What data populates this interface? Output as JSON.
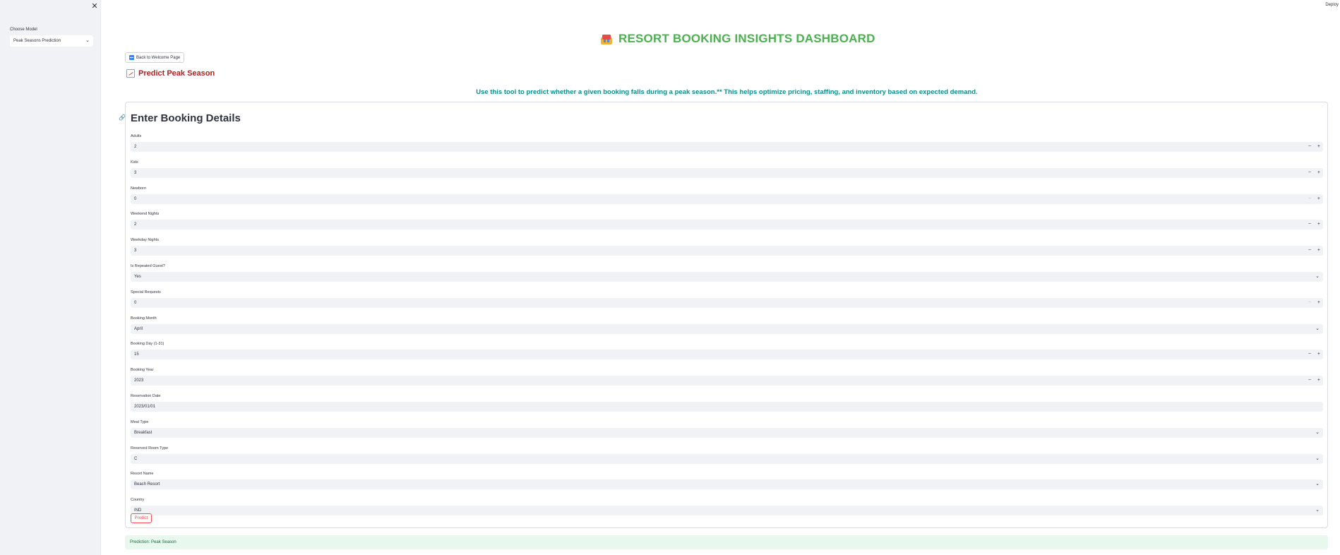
{
  "sidebar": {
    "model_label": "Choose Model",
    "model_value": "Peak Seasons Prediction"
  },
  "header": {
    "deploy_label": "Deploy"
  },
  "main": {
    "title": "RESORT BOOKING INSIGHTS DASHBOARD",
    "back_button": "Back to Welcome Page",
    "subheading": "Predict Peak Season",
    "intro": "Use this tool to predict whether a given booking falls during a peak season.** This helps optimize pricing, staffing, and inventory based on expected demand."
  },
  "form": {
    "heading": "Enter Booking Details",
    "fields": [
      {
        "label": "Adults",
        "value": "2",
        "kind": "number"
      },
      {
        "label": "Kids",
        "value": "3",
        "kind": "number"
      },
      {
        "label": "Newborn",
        "value": "0",
        "kind": "number-min"
      },
      {
        "label": "Weekend Nights",
        "value": "2",
        "kind": "number"
      },
      {
        "label": "Weekday Nights",
        "value": "3",
        "kind": "number"
      },
      {
        "label": "Is Repeated Guest?",
        "value": "Yes",
        "kind": "select"
      },
      {
        "label": "Special Requests",
        "value": "0",
        "kind": "number-min"
      },
      {
        "label": "Booking Month",
        "value": "April",
        "kind": "select"
      },
      {
        "label": "Booking Day (1-31)",
        "value": "15",
        "kind": "number"
      },
      {
        "label": "Booking Year",
        "value": "2023",
        "kind": "number"
      },
      {
        "label": "Reservation Date",
        "value": "2023/01/01",
        "kind": "date"
      },
      {
        "label": "Meal Type",
        "value": "Breakfast",
        "kind": "select"
      },
      {
        "label": "Reserved Room Type",
        "value": "C",
        "kind": "select"
      },
      {
        "label": "Resort Name",
        "value": "Beach Resort",
        "kind": "select"
      },
      {
        "label": "Country",
        "value": "IND",
        "kind": "select"
      }
    ],
    "predict_button": "Predict"
  },
  "result": {
    "text": "Prediction: Peak Season"
  },
  "colors": {
    "title_green": "#4caf50",
    "subheading_red": "#b22222",
    "intro_teal": "#0e8b8b",
    "accent_red": "#ff4b4b",
    "success_bg": "#e9f8ef"
  }
}
